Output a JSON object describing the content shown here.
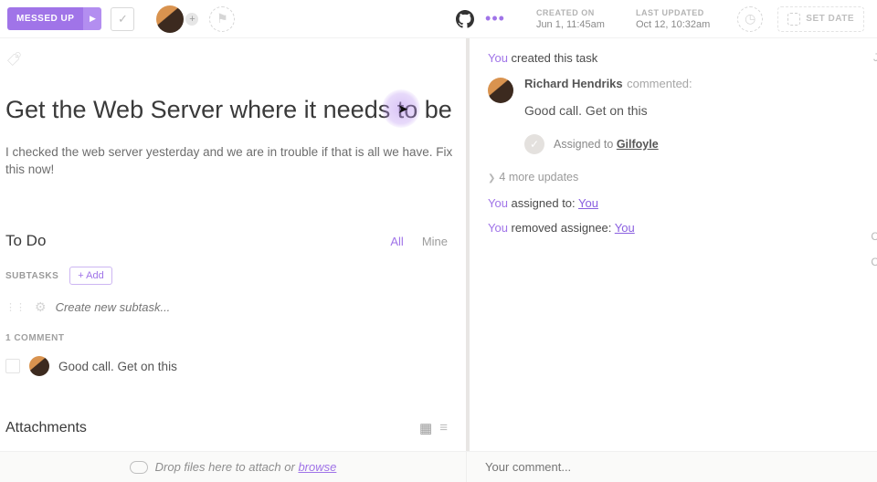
{
  "toolbar": {
    "status": "MESSED UP",
    "set_date": "SET DATE"
  },
  "meta": {
    "created_label": "CREATED ON",
    "created_value": "Jun 1, 11:45am",
    "updated_label": "LAST UPDATED",
    "updated_value": "Oct 12, 10:32am"
  },
  "task": {
    "title": "Get the Web Server where it needs to be",
    "description": "I checked the web server yesterday and we are in trouble if that is all we have. Fix this now!"
  },
  "todo": {
    "heading": "To Do",
    "filter_all": "All",
    "filter_mine": "Mine",
    "subtasks_label": "SUBTASKS",
    "add_label": "+ Add",
    "new_subtask_placeholder": "Create new subtask..."
  },
  "comments": {
    "label": "1 COMMENT",
    "items": [
      "Good call. Get on this"
    ]
  },
  "attachments": {
    "heading": "Attachments"
  },
  "activity": {
    "created_prefix": "You",
    "created_suffix": " created this task",
    "commenter": "Richard Hendriks",
    "commented_word": " commented:",
    "comment_body": "Good call. Get on this",
    "assigned_to_label": "Assigned to",
    "assigned_to_name": "Gilfoyle",
    "more_updates": "4 more updates",
    "line_assigned_prefix": "You",
    "line_assigned_mid": " assigned to: ",
    "line_assigned_target": "You",
    "line_removed_prefix": "You",
    "line_removed_mid": " removed assignee: ",
    "line_removed_target": "You"
  },
  "footer": {
    "drop_text": "Drop files here to attach or ",
    "browse": "browse",
    "comment_placeholder": "Your comment..."
  }
}
